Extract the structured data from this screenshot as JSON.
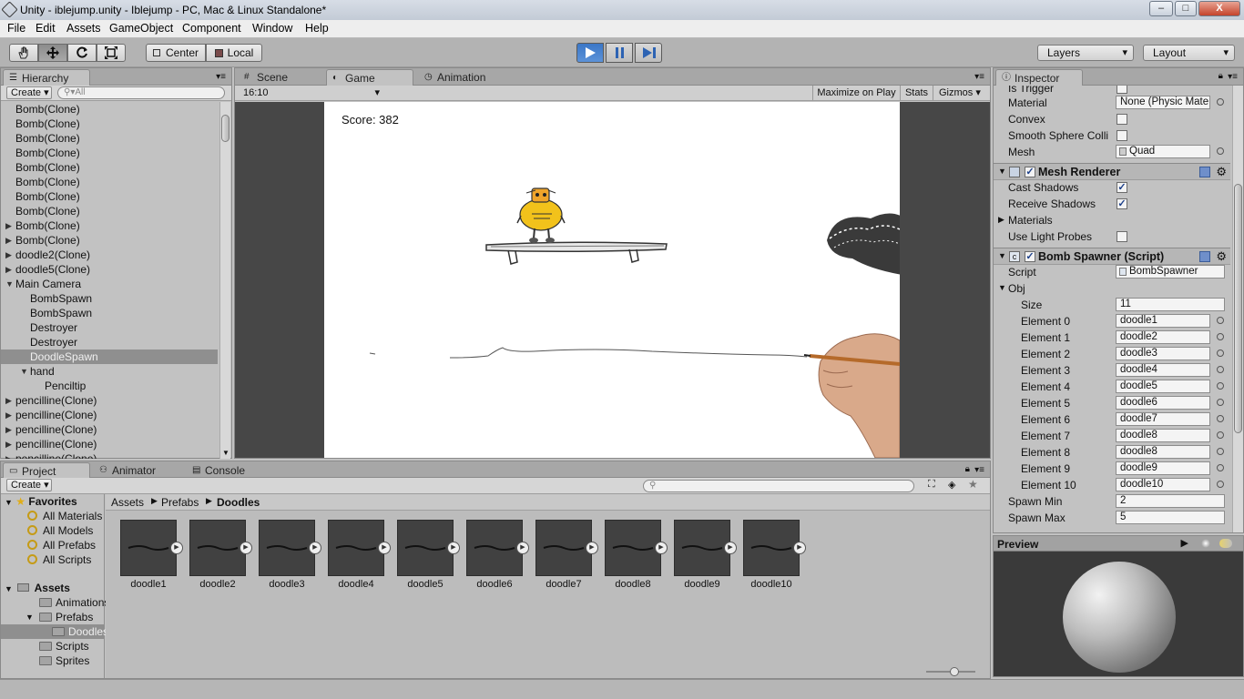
{
  "window": {
    "title": "Unity - iblejump.unity - Iblejump - PC, Mac & Linux Standalone*",
    "min": "–",
    "max": "□",
    "close": "X"
  },
  "menu": [
    "File",
    "Edit",
    "Assets",
    "GameObject",
    "Component",
    "Window",
    "Help"
  ],
  "toolbar": {
    "center": "Center",
    "local": "Local",
    "layers": "Layers",
    "layout": "Layout"
  },
  "hierarchy": {
    "tab": "Hierarchy",
    "create": "Create",
    "search_placeholder": "All",
    "rows": [
      {
        "label": "Bomb(Clone)",
        "indent": 0,
        "arrow": ""
      },
      {
        "label": "Bomb(Clone)",
        "indent": 0,
        "arrow": ""
      },
      {
        "label": "Bomb(Clone)",
        "indent": 0,
        "arrow": ""
      },
      {
        "label": "Bomb(Clone)",
        "indent": 0,
        "arrow": ""
      },
      {
        "label": "Bomb(Clone)",
        "indent": 0,
        "arrow": ""
      },
      {
        "label": "Bomb(Clone)",
        "indent": 0,
        "arrow": ""
      },
      {
        "label": "Bomb(Clone)",
        "indent": 0,
        "arrow": ""
      },
      {
        "label": "Bomb(Clone)",
        "indent": 0,
        "arrow": ""
      },
      {
        "label": "Bomb(Clone)",
        "indent": 0,
        "arrow": "▶"
      },
      {
        "label": "Bomb(Clone)",
        "indent": 0,
        "arrow": "▶"
      },
      {
        "label": "doodle2(Clone)",
        "indent": 0,
        "arrow": "▶"
      },
      {
        "label": "doodle5(Clone)",
        "indent": 0,
        "arrow": "▶"
      },
      {
        "label": "Main Camera",
        "indent": 0,
        "arrow": "▼"
      },
      {
        "label": "BombSpawn",
        "indent": 1,
        "arrow": ""
      },
      {
        "label": "BombSpawn",
        "indent": 1,
        "arrow": ""
      },
      {
        "label": "Destroyer",
        "indent": 1,
        "arrow": ""
      },
      {
        "label": "Destroyer",
        "indent": 1,
        "arrow": ""
      },
      {
        "label": "DoodleSpawn",
        "indent": 1,
        "arrow": "",
        "selected": true
      },
      {
        "label": "hand",
        "indent": 1,
        "arrow": "▼"
      },
      {
        "label": "Penciltip",
        "indent": 2,
        "arrow": ""
      },
      {
        "label": "pencilline(Clone)",
        "indent": 0,
        "arrow": "▶"
      },
      {
        "label": "pencilline(Clone)",
        "indent": 0,
        "arrow": "▶"
      },
      {
        "label": "pencilline(Clone)",
        "indent": 0,
        "arrow": "▶"
      },
      {
        "label": "pencilline(Clone)",
        "indent": 0,
        "arrow": "▶"
      },
      {
        "label": "pencilline(Clone)",
        "indent": 0,
        "arrow": "▶"
      }
    ]
  },
  "views": {
    "tabs": [
      "Scene",
      "Game",
      "Animation"
    ],
    "aspect": "16:10",
    "maximize": "Maximize on Play",
    "stats": "Stats",
    "gizmos": "Gizmos",
    "score": "Score: 382"
  },
  "inspector": {
    "tab": "Inspector",
    "collider": [
      {
        "label": "Is Trigger",
        "type": "check",
        "value": false
      },
      {
        "label": "Material",
        "type": "obj",
        "value": "None (Physic Mate"
      },
      {
        "label": "Convex",
        "type": "check",
        "value": false
      },
      {
        "label": "Smooth Sphere Colli",
        "type": "check",
        "value": false
      },
      {
        "label": "Mesh",
        "type": "obj",
        "value": "Quad"
      }
    ],
    "mesh_renderer": {
      "title": "Mesh Renderer",
      "rows": [
        {
          "label": "Cast Shadows",
          "type": "check",
          "value": true
        },
        {
          "label": "Receive Shadows",
          "type": "check",
          "value": true
        },
        {
          "label": "Materials",
          "type": "fold"
        },
        {
          "label": "Use Light Probes",
          "type": "check",
          "value": false
        }
      ]
    },
    "bomb_spawner": {
      "title": "Bomb Spawner (Script)",
      "script_label": "Script",
      "script_value": "BombSpawner",
      "obj_label": "Obj",
      "size_label": "Size",
      "size_value": "11",
      "elements": [
        {
          "label": "Element 0",
          "value": "doodle1"
        },
        {
          "label": "Element 1",
          "value": "doodle2"
        },
        {
          "label": "Element 2",
          "value": "doodle3"
        },
        {
          "label": "Element 3",
          "value": "doodle4"
        },
        {
          "label": "Element 4",
          "value": "doodle5"
        },
        {
          "label": "Element 5",
          "value": "doodle6"
        },
        {
          "label": "Element 6",
          "value": "doodle7"
        },
        {
          "label": "Element 7",
          "value": "doodle8"
        },
        {
          "label": "Element 8",
          "value": "doodle8"
        },
        {
          "label": "Element 9",
          "value": "doodle9"
        },
        {
          "label": "Element 10",
          "value": "doodle10"
        }
      ],
      "spawn_min_label": "Spawn Min",
      "spawn_min": "2",
      "spawn_max_label": "Spawn Max",
      "spawn_max": "5"
    },
    "preview": "Preview"
  },
  "project": {
    "tabs": [
      "Project",
      "Animator",
      "Console"
    ],
    "create": "Create",
    "favorites_label": "Favorites",
    "favorites": [
      "All Materials",
      "All Models",
      "All Prefabs",
      "All Scripts"
    ],
    "assets_label": "Assets",
    "assets": [
      {
        "label": "Animations",
        "indent": 1,
        "arrow": ""
      },
      {
        "label": "Prefabs",
        "indent": 1,
        "arrow": "▼"
      },
      {
        "label": "Doodles",
        "indent": 2,
        "arrow": "",
        "selected": true
      },
      {
        "label": "Scripts",
        "indent": 1,
        "arrow": ""
      },
      {
        "label": "Sprites",
        "indent": 1,
        "arrow": ""
      }
    ],
    "breadcrumb": [
      "Assets",
      "Prefabs",
      "Doodles"
    ],
    "items": [
      "doodle1",
      "doodle2",
      "doodle3",
      "doodle4",
      "doodle5",
      "doodle6",
      "doodle7",
      "doodle8",
      "doodle9",
      "doodle10"
    ]
  }
}
